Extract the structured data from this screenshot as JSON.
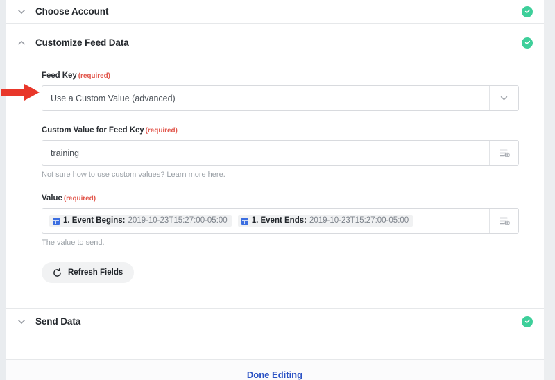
{
  "colors": {
    "accent_red": "#e8372a",
    "success_green": "#3ecf9a",
    "required_red": "#e2574c",
    "link_blue": "#2b52c4",
    "token_blue": "#3c6ee0"
  },
  "steps": [
    {
      "id": "choose-account",
      "title": "Choose Account",
      "expanded": false,
      "chevron_icon": "chevron-down-icon",
      "status_icon": "check-circle-icon"
    },
    {
      "id": "customize-feed-data",
      "title": "Customize Feed Data",
      "expanded": true,
      "chevron_icon": "chevron-up-icon",
      "status_icon": "check-circle-icon"
    },
    {
      "id": "send-data",
      "title": "Send Data",
      "expanded": false,
      "chevron_icon": "chevron-down-icon",
      "status_icon": "check-circle-icon"
    }
  ],
  "form": {
    "feed_key": {
      "label": "Feed Key",
      "required_text": "(required)",
      "value": "Use a Custom Value (advanced)",
      "dropdown_icon": "chevron-down-icon"
    },
    "custom_value": {
      "label": "Custom Value for Feed Key",
      "required_text": "(required)",
      "value": "training",
      "insert_icon": "insert-field-icon",
      "helper_prefix": "Not sure how to use custom values? ",
      "helper_link": "Learn more here",
      "helper_suffix": "."
    },
    "value": {
      "label": "Value",
      "required_text": "(required)",
      "insert_icon": "insert-field-icon",
      "helper": "The value to send.",
      "tokens": [
        {
          "icon": "calendar-field-icon",
          "name": "1. Event Begins:",
          "value": "2019-10-23T15:27:00-05:00"
        },
        {
          "icon": "calendar-field-icon",
          "name": "1. Event Ends:",
          "value": "2019-10-23T15:27:00-05:00"
        }
      ]
    },
    "refresh_button": {
      "label": "Refresh Fields",
      "icon": "refresh-icon"
    }
  },
  "footer": {
    "done_editing_label": "Done Editing"
  },
  "annotation": {
    "arrow_icon": "red-arrow-right-icon"
  }
}
